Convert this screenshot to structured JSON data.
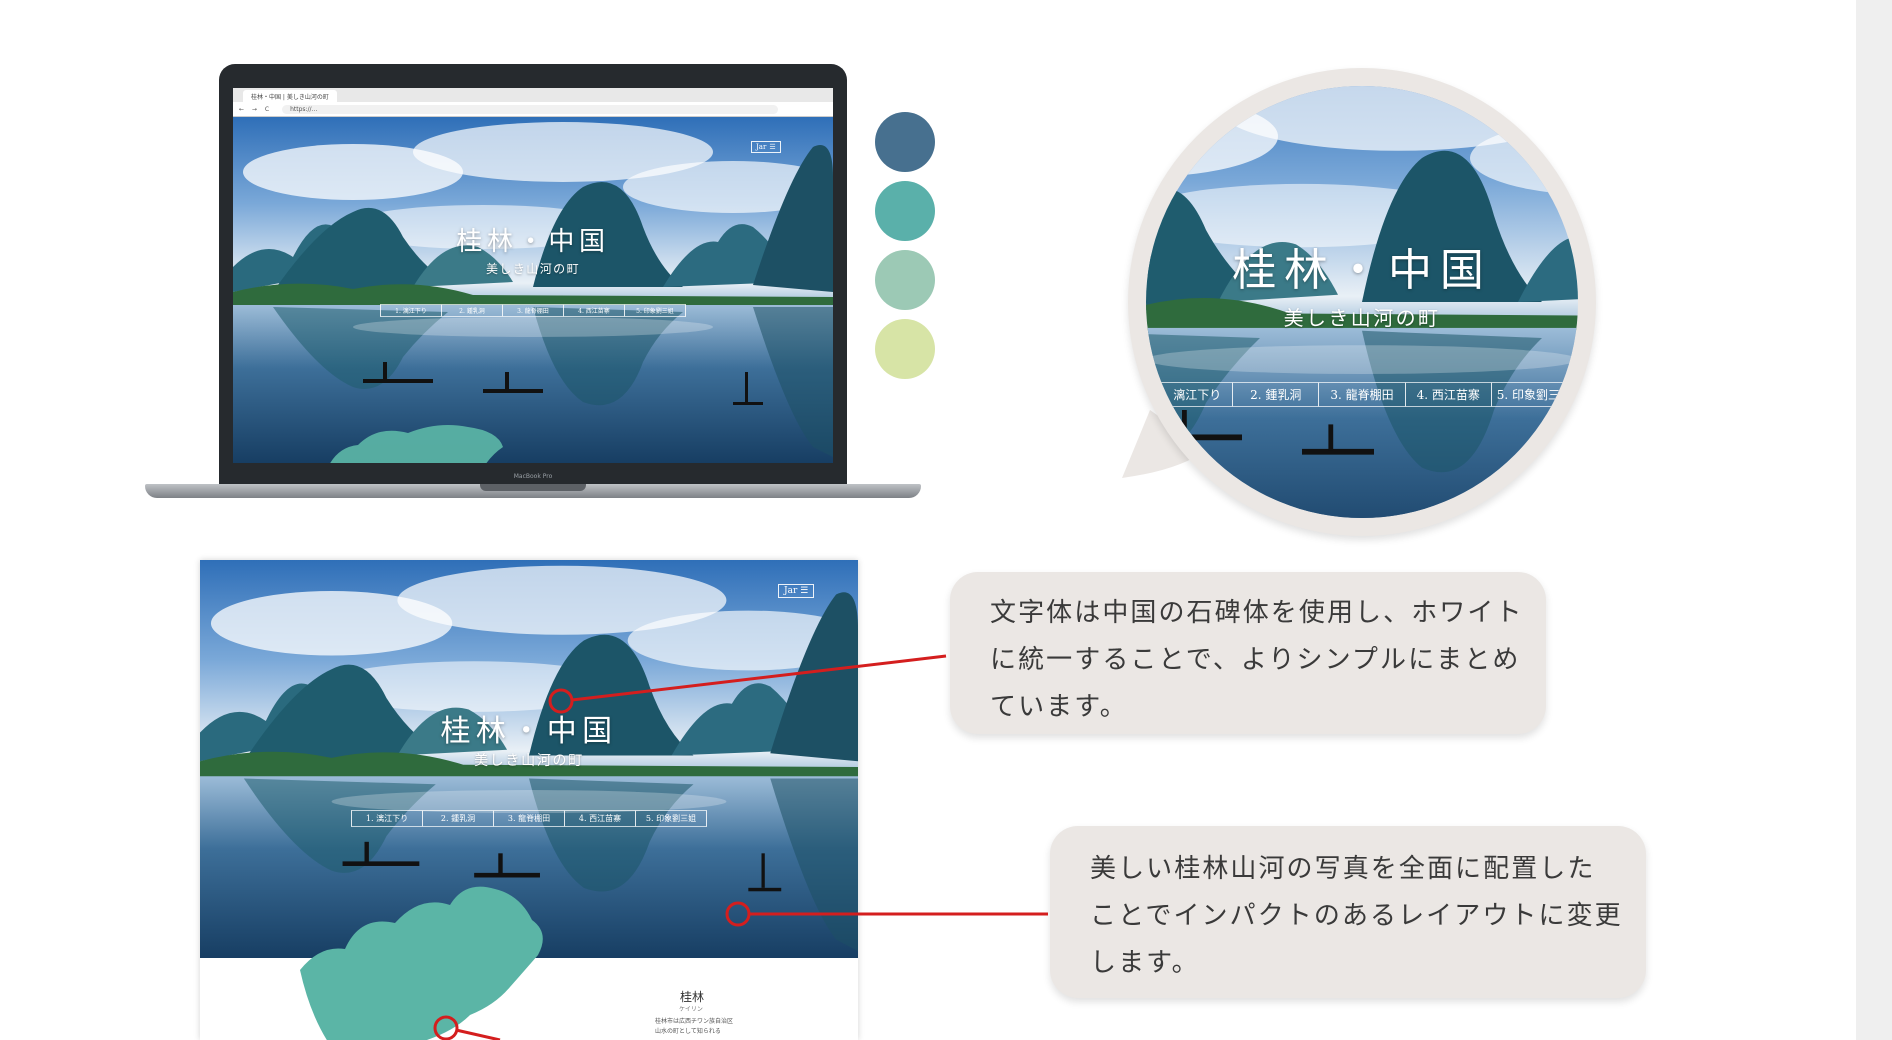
{
  "colors": {
    "swatches": [
      "#47708f",
      "#5ab0aa",
      "#9cc9b5",
      "#d7e4a6"
    ],
    "callout_bg": "#ebe7e4",
    "leader_line": "#d41e1e",
    "map_teal": "#5bb5a6"
  },
  "hero": {
    "title": "桂林・中国",
    "subtitle": "美しき山河の町",
    "lang_label": "Jar",
    "nav": [
      "1. 漓江下り",
      "2. 鍾乳洞",
      "3. 龍脊棚田",
      "4. 西江苗寨",
      "5. 印象劉三姐"
    ]
  },
  "browser": {
    "tab_label": "桂林・中国 | 美しき山河の町",
    "nav_icons": "← → C",
    "url": "https://..."
  },
  "laptop": {
    "brand": "MacBook Pro"
  },
  "page_preview": {
    "section_title": "桂林",
    "section_sub": "ケイリン",
    "section_text_1": "桂林市は広西チワン族自治区",
    "section_text_2": "山水の町として知られる"
  },
  "callouts": [
    {
      "lines": [
        "文字体は中国の石碑体を使用し、ホワイト",
        "に統一することで、よりシンプルにまとめ",
        "ています。"
      ]
    },
    {
      "lines": [
        "美しい桂林山河の写真を全面に配置した",
        "ことでインパクトのあるレイアウトに変更",
        "します。"
      ]
    }
  ]
}
